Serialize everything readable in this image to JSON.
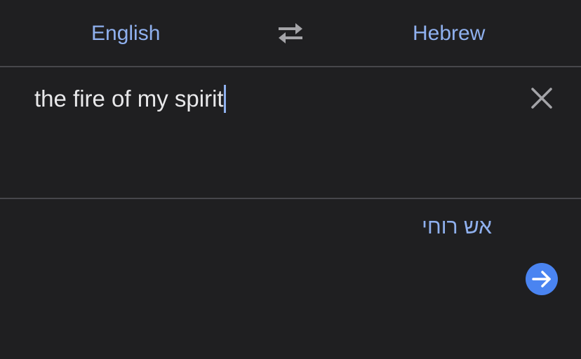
{
  "header": {
    "source_language": "English",
    "target_language": "Hebrew"
  },
  "input": {
    "text": "the fire of my spirit"
  },
  "output": {
    "translation": "אש רוחי"
  },
  "icons": {
    "swap": "swap-arrows-icon",
    "clear": "close-icon",
    "go": "arrow-right-circle-icon"
  },
  "colors": {
    "background": "#1f1f21",
    "accent": "#8fb0ee",
    "button": "#4a84f1",
    "text": "#e8e8ea",
    "divider": "#47474b"
  }
}
